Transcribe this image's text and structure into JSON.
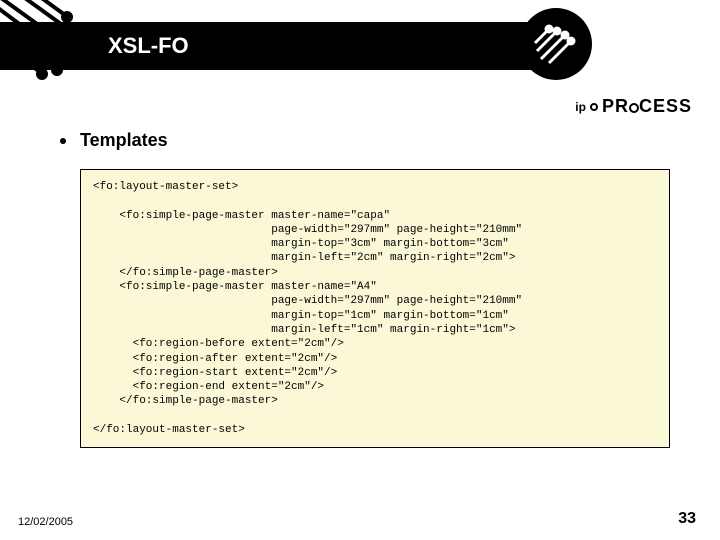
{
  "header": {
    "title": "XSL-FO"
  },
  "brand": {
    "ip": "ip",
    "text": "PR CESS"
  },
  "bullet": {
    "label": "Templates"
  },
  "code": {
    "line1": "<fo:layout-master-set>",
    "line2": "",
    "line3": "    <fo:simple-page-master master-name=\"capa\"",
    "line4": "                           page-width=\"297mm\" page-height=\"210mm\"",
    "line5": "                           margin-top=\"3cm\" margin-bottom=\"3cm\"",
    "line6": "                           margin-left=\"2cm\" margin-right=\"2cm\">",
    "line7": "    </fo:simple-page-master>",
    "line8": "    <fo:simple-page-master master-name=\"A4\"",
    "line9": "                           page-width=\"297mm\" page-height=\"210mm\"",
    "line10": "                           margin-top=\"1cm\" margin-bottom=\"1cm\"",
    "line11": "                           margin-left=\"1cm\" margin-right=\"1cm\">",
    "line12": "      <fo:region-before extent=\"2cm\"/>",
    "line13": "      <fo:region-after extent=\"2cm\"/>",
    "line14": "      <fo:region-start extent=\"2cm\"/>",
    "line15": "      <fo:region-end extent=\"2cm\"/>",
    "line16": "    </fo:simple-page-master>",
    "line17": "",
    "line18": "</fo:layout-master-set>"
  },
  "footer": {
    "date": "12/02/2005",
    "page": "33"
  }
}
